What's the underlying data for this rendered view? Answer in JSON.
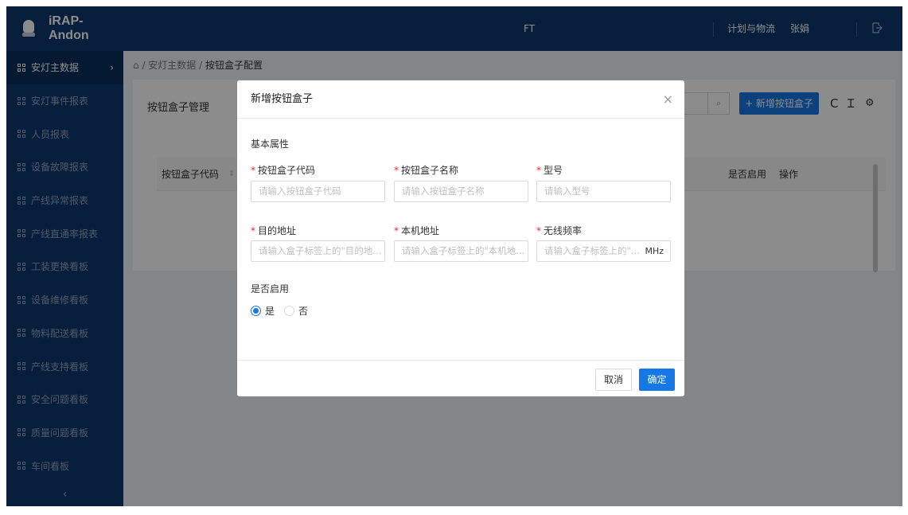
{
  "header": {
    "app_name": "iRAP-Andon",
    "center_label": "FT",
    "links": [
      "计划与物流",
      "张娟"
    ],
    "colors": {
      "nav_bg": "#0e3a6e",
      "accent": "#1677e6"
    },
    "exit_icon": "logout-icon"
  },
  "sidebar": {
    "items": [
      {
        "label": "安灯主数据",
        "active": true
      },
      {
        "label": "安灯事件报表"
      },
      {
        "label": "人员报表"
      },
      {
        "label": "设备故障报表"
      },
      {
        "label": "产线异常报表"
      },
      {
        "label": "产线直通率报表"
      },
      {
        "label": "工装更换看板"
      },
      {
        "label": "设备维修看板"
      },
      {
        "label": "物料配送看板"
      },
      {
        "label": "产线支持看板"
      },
      {
        "label": "安全问题看板"
      },
      {
        "label": "质量问题看板"
      },
      {
        "label": "车间看板"
      }
    ],
    "expand_arrow": "›",
    "collapse": "‹"
  },
  "breadcrumb": {
    "home_icon": "⌂",
    "sep1": " / ",
    "parent": "安灯主数据",
    "sep2": " / ",
    "current": "按钮盒子配置"
  },
  "page": {
    "title": "按钮盒子管理",
    "add_button": "+ 新增按钮盒子",
    "search_icon": "⌕",
    "tool_icons": [
      "C",
      "Ɪ",
      "⚙"
    ],
    "table": {
      "columns": [
        "按钮盒子代码",
        "是否启用",
        "操作"
      ],
      "sort_icon": "⇕"
    }
  },
  "modal": {
    "title": "新增按钮盒子",
    "close": "×",
    "section": "基本属性",
    "required_mark": "*",
    "fields": [
      {
        "label": "按钮盒子代码",
        "placeholder": "请输入按钮盒子代码"
      },
      {
        "label": "按钮盒子名称",
        "placeholder": "请输入按钮盒子名称"
      },
      {
        "label": "型号",
        "placeholder": "请输入型号"
      },
      {
        "label": "目的地址",
        "placeholder": "请输入盒子标签上的\"目的地..."
      },
      {
        "label": "本机地址",
        "placeholder": "请输入盒子标签上的\"本机地..."
      },
      {
        "label": "无线频率",
        "placeholder": "请输入盒子标签上的\"...",
        "suffix": "MHz"
      }
    ],
    "enable": {
      "label": "是否启用",
      "options": [
        "是",
        "否"
      ],
      "selected": "是"
    },
    "cancel": "取消",
    "ok": "确定"
  }
}
